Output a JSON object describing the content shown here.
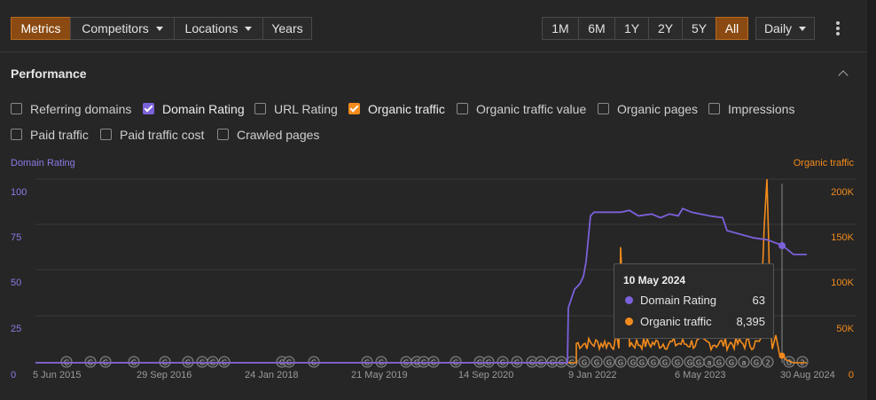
{
  "toolbar": {
    "left_tabs": [
      {
        "label": "Metrics",
        "active": true
      },
      {
        "label": "Competitors",
        "dropdown": true
      },
      {
        "label": "Locations",
        "dropdown": true
      },
      {
        "label": "Years"
      }
    ],
    "ranges": [
      {
        "label": "1M"
      },
      {
        "label": "6M"
      },
      {
        "label": "1Y"
      },
      {
        "label": "2Y"
      },
      {
        "label": "5Y"
      },
      {
        "label": "All",
        "active": true
      }
    ],
    "interval": "Daily"
  },
  "section": {
    "title": "Performance"
  },
  "checkboxes": [
    {
      "label": "Referring domains",
      "checked": false
    },
    {
      "label": "Domain Rating",
      "checked": true,
      "color": "#7b61d9"
    },
    {
      "label": "URL Rating",
      "checked": false
    },
    {
      "label": "Organic traffic",
      "checked": true,
      "color": "#f38b1c"
    },
    {
      "label": "Organic traffic value",
      "checked": false
    },
    {
      "label": "Organic pages",
      "checked": false
    },
    {
      "label": "Impressions",
      "checked": false
    },
    {
      "label": "Paid traffic",
      "checked": false
    },
    {
      "label": "Paid traffic cost",
      "checked": false
    },
    {
      "label": "Crawled pages",
      "checked": false
    }
  ],
  "chart": {
    "left_axis_title": "Domain Rating",
    "right_axis_title": "Organic traffic",
    "left_ticks": [
      "100",
      "75",
      "50",
      "25",
      "0"
    ],
    "right_ticks": [
      "200K",
      "150K",
      "100K",
      "50K",
      "0"
    ],
    "x_ticks": [
      "5 Jun 2015",
      "29 Sep 2016",
      "24 Jan 2018",
      "21 May 2019",
      "14 Sep 2020",
      "9 Jan 2022",
      "6 May 2023",
      "30 Aug 2024"
    ],
    "colors": {
      "dr": "#7b61d9",
      "traffic": "#f38b1c"
    },
    "annotation_labels": [
      "G",
      "a",
      "2"
    ]
  },
  "tooltip": {
    "date": "10 May 2024",
    "rows": [
      {
        "name": "Domain Rating",
        "value": "63",
        "color": "#7b61d9"
      },
      {
        "name": "Organic traffic",
        "value": "8,395",
        "color": "#f38b1c"
      }
    ]
  }
}
